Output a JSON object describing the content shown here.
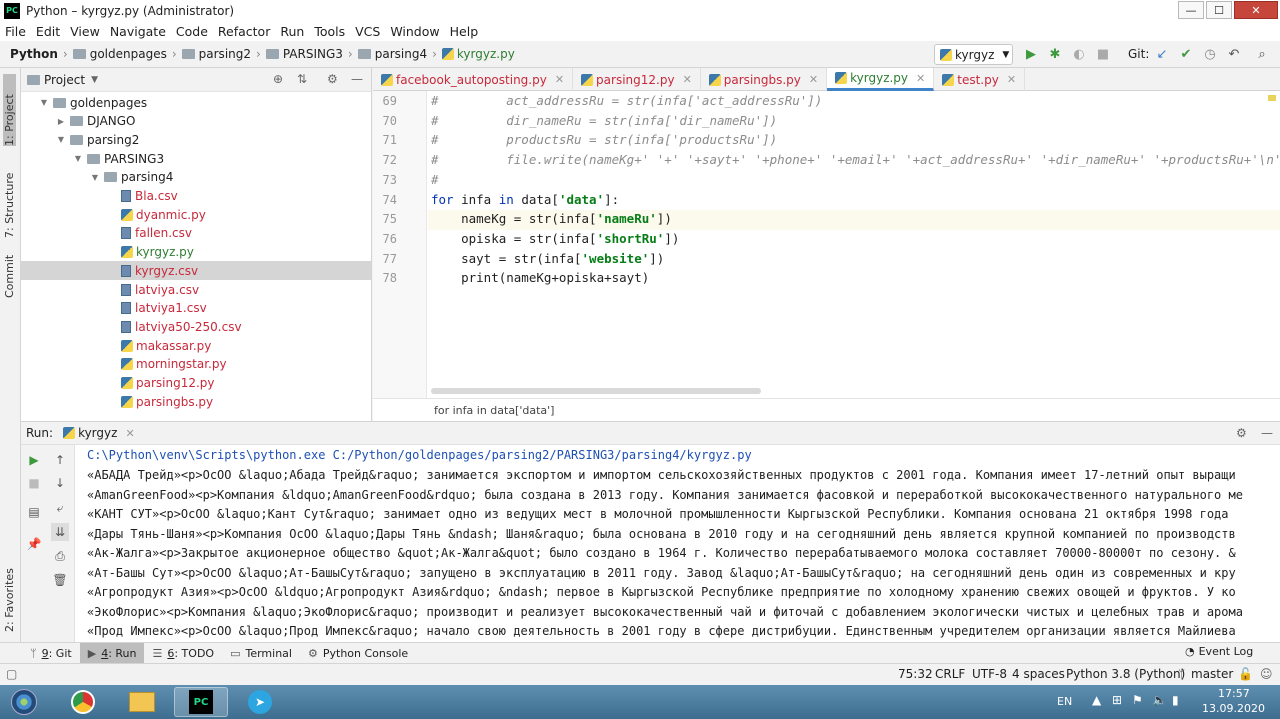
{
  "window": {
    "title": "Python – kyrgyz.py (Administrator)",
    "min": "—",
    "max": "☐",
    "close": "✕"
  },
  "menu": [
    "File",
    "Edit",
    "View",
    "Navigate",
    "Code",
    "Refactor",
    "Run",
    "Tools",
    "VCS",
    "Window",
    "Help"
  ],
  "breadcrumb": [
    "Python",
    "goldenpages",
    "parsing2",
    "PARSING3",
    "parsing4",
    "kyrgyz.py"
  ],
  "run_config": {
    "name": "kyrgyz",
    "git_label": "Git:"
  },
  "left_strip": {
    "project": "1: Project",
    "structure": "7: Structure",
    "commit": "Commit",
    "favorites": "2: Favorites"
  },
  "project": {
    "title": "Project",
    "tree": [
      {
        "name": "goldenpages",
        "type": "folder",
        "expanded": true,
        "depth": 0
      },
      {
        "name": "DJANGO",
        "type": "folder",
        "expanded": false,
        "depth": 1
      },
      {
        "name": "parsing2",
        "type": "folder",
        "expanded": true,
        "depth": 1
      },
      {
        "name": "PARSING3",
        "type": "folder",
        "expanded": true,
        "depth": 2
      },
      {
        "name": "parsing4",
        "type": "folder",
        "expanded": true,
        "depth": 3
      },
      {
        "name": "Bla.csv",
        "type": "csv",
        "depth": 4
      },
      {
        "name": "dyanmic.py",
        "type": "py",
        "depth": 4
      },
      {
        "name": "fallen.csv",
        "type": "csv",
        "depth": 4
      },
      {
        "name": "kyrgyz.py",
        "type": "py-green",
        "depth": 4
      },
      {
        "name": "kyrgyz.csv",
        "type": "csv",
        "depth": 4,
        "selected": true
      },
      {
        "name": "latviya.csv",
        "type": "csv",
        "depth": 4
      },
      {
        "name": "latviya1.csv",
        "type": "csv",
        "depth": 4
      },
      {
        "name": "latviya50-250.csv",
        "type": "csv",
        "depth": 4
      },
      {
        "name": "makassar.py",
        "type": "py",
        "depth": 4
      },
      {
        "name": "morningstar.py",
        "type": "py",
        "depth": 4
      },
      {
        "name": "parsing12.py",
        "type": "py",
        "depth": 4
      },
      {
        "name": "parsingbs.py",
        "type": "py",
        "depth": 4
      }
    ]
  },
  "tabs": [
    {
      "label": "facebook_autoposting.py",
      "active": false
    },
    {
      "label": "parsing12.py",
      "active": false
    },
    {
      "label": "parsingbs.py",
      "active": false
    },
    {
      "label": "kyrgyz.py",
      "active": true
    },
    {
      "label": "test.py",
      "active": false
    }
  ],
  "editor": {
    "lines": [
      {
        "n": "69",
        "html": "<span class=\"cmt\">#         act_addressRu = str(infa['act_addressRu'])</span>"
      },
      {
        "n": "70",
        "html": "<span class=\"cmt\">#         dir_nameRu = str(infa['dir_nameRu'])</span>"
      },
      {
        "n": "71",
        "html": "<span class=\"cmt\">#         productsRu = str(infa['productsRu'])</span>"
      },
      {
        "n": "72",
        "html": "<span class=\"cmt\">#         file.write(nameKg+' '+' '+sayt+' '+phone+' '+email+' '+act_addressRu+' '+dir_nameRu+' '+productsRu+'\\n')</span>"
      },
      {
        "n": "73",
        "html": "<span class=\"cmt\">#</span>"
      },
      {
        "n": "74",
        "html": "<span class=\"kw\">for</span> infa <span class=\"kw\">in</span> data[<span class=\"str\">'data'</span>]:"
      },
      {
        "n": "75",
        "html": "    nameKg = str(infa[<span class=\"str\">'nameRu'</span>])"
      },
      {
        "n": "76",
        "html": "    opiska = str(infa[<span class=\"str\">'shortRu'</span>])"
      },
      {
        "n": "77",
        "html": "    sayt = str(infa[<span class=\"str\">'website'</span>])"
      },
      {
        "n": "78",
        "html": "    print(nameKg+opiska+sayt)"
      }
    ],
    "current_line": "75",
    "breadcrumb": "for infa in data['data']"
  },
  "run": {
    "label": "Run:",
    "config": "kyrgyz",
    "command": "C:\\Python\\venv\\Scripts\\python.exe C:/Python/goldenpages/parsing2/PARSING3/parsing4/kyrgyz.py",
    "output": [
      "«АБАДА Трейд»<p>ОсОО &laquo;Абада Трейд&raquo; занимается экспортом и импортом сельскохозяйственных продуктов с 2001 года. Компания имеет 17-летний опыт выращи",
      "«AmanGreenFood»<p>Компания &ldquo;AmanGreenFood&rdquo; была создана в 2013 году. Компания занимается фасовкой и переработкой высококачественного натурального ме",
      "«КАНТ СУТ»<p>ОсОО &laquo;Кант Сут&raquo; занимает одно из ведущих мест в молочной промышленности Кыргызской Республики. Компания основана 21 октября 1998 года",
      "«Дары Тянь-Шаня»<p>Компания ОсОО &laquo;Дары Тянь &ndash; Шаня&raquo; была основана в 2010 году и на сегодняшний день является крупной компанией по производств",
      "«Ак-Жалга»<p>Закрытое акционерное общество &quot;Ак-Жалга&quot; было создано в 1964 г. Количество перерабатываемого молока составляет 70000-80000т по сезону. &",
      "«Ат-Башы Сут»<p>ОсОО &laquo;Ат-БашыСут&raquo; запущено в эксплуатацию в 2011 году. Завод &laquo;Ат-БашыСут&raquo; на сегодняшний день один из современных и кру",
      "«Агропродукт Азия»<p>ОсОО &ldquo;Агропродукт Азия&rdquo; &ndash; первое в Кыргызской Республике предприятие по холодному хранению свежих овощей и фруктов. У ко",
      "«ЭкоФлорис»<p>Компания &laquo;ЭкоФлорис&raquo; производит и реализует высококачественный чай и фиточай с добавлением экологически чистых и целебных трав и арома",
      "«Прод Импекс»<p>ОсОО &laquo;Прод Импекс&raquo; начало свою деятельность в 2001 году в сфере дистрибуции. Единственным учредителем организации является Майлиева"
    ]
  },
  "bottom_tools": [
    {
      "key": "9",
      "label": ": Git",
      "icon": "ᛘ",
      "active": false
    },
    {
      "key": "4",
      "label": ": Run",
      "icon": "▶",
      "active": true
    },
    {
      "key": "6",
      "label": ": TODO",
      "icon": "☰",
      "active": false
    },
    {
      "key": "",
      "label": "Terminal",
      "icon": "▭",
      "active": false
    },
    {
      "key": "",
      "label": "Python Console",
      "icon": "⚙",
      "active": false
    }
  ],
  "event_log": "Event Log",
  "status": {
    "position": "75:32",
    "line_sep": "CRLF",
    "encoding": "UTF-8",
    "indent": "4 spaces",
    "interpreter": "Python 3.8 (Python)",
    "branch": "master"
  },
  "taskbar": {
    "lang": "EN",
    "time": "17:57",
    "date": "13.09.2020"
  }
}
